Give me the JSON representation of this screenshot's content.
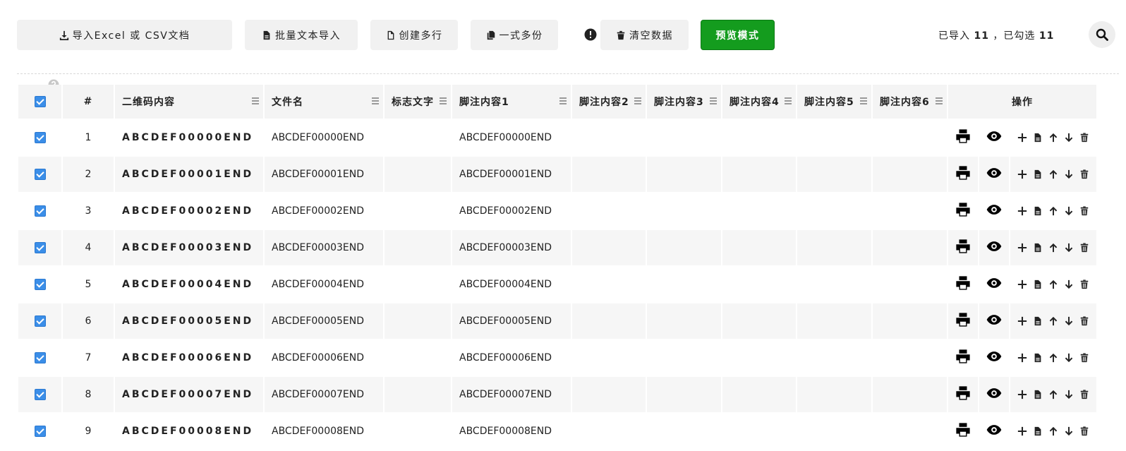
{
  "toolbar": {
    "import_excel": "导入Excel 或 CSV文档",
    "batch_text": "批量文本导入",
    "create_rows": "创建多行",
    "multi_copy": "一式多份",
    "clear_data": "清空数据",
    "preview_mode": "预览模式",
    "status_prefix": "已导入",
    "imported_count": "11",
    "status_sep": "，已勾选",
    "checked_count": "11"
  },
  "table": {
    "headers": {
      "index": "#",
      "qr": "二维码内容",
      "filename": "文件名",
      "flag": "标志文字",
      "foot1": "脚注内容1",
      "foot2": "脚注内容2",
      "foot3": "脚注内容3",
      "foot4": "脚注内容4",
      "foot5": "脚注内容5",
      "foot6": "脚注内容6",
      "ops": "操作"
    },
    "rows": [
      {
        "index": "1",
        "qr": "ABCDEF00000END",
        "filename": "ABCDEF00000END",
        "flag": "",
        "foot1": "ABCDEF00000END"
      },
      {
        "index": "2",
        "qr": "ABCDEF00001END",
        "filename": "ABCDEF00001END",
        "flag": "",
        "foot1": "ABCDEF00001END"
      },
      {
        "index": "3",
        "qr": "ABCDEF00002END",
        "filename": "ABCDEF00002END",
        "flag": "",
        "foot1": "ABCDEF00002END"
      },
      {
        "index": "4",
        "qr": "ABCDEF00003END",
        "filename": "ABCDEF00003END",
        "flag": "",
        "foot1": "ABCDEF00003END"
      },
      {
        "index": "5",
        "qr": "ABCDEF00004END",
        "filename": "ABCDEF00004END",
        "flag": "",
        "foot1": "ABCDEF00004END"
      },
      {
        "index": "6",
        "qr": "ABCDEF00005END",
        "filename": "ABCDEF00005END",
        "flag": "",
        "foot1": "ABCDEF00005END"
      },
      {
        "index": "7",
        "qr": "ABCDEF00006END",
        "filename": "ABCDEF00006END",
        "flag": "",
        "foot1": "ABCDEF00006END"
      },
      {
        "index": "8",
        "qr": "ABCDEF00007END",
        "filename": "ABCDEF00007END",
        "flag": "",
        "foot1": "ABCDEF00007END"
      },
      {
        "index": "9",
        "qr": "ABCDEF00008END",
        "filename": "ABCDEF00008END",
        "flag": "",
        "foot1": "ABCDEF00008END"
      }
    ]
  },
  "icons": {
    "download": "download-icon",
    "file": "file-icon",
    "file_outline": "file-outline-icon",
    "copy": "copy-icon",
    "alert": "exclamation-circle-icon",
    "trash": "trash-icon",
    "search": "search-icon",
    "help": "question-circle-icon",
    "print": "print-icon",
    "eye": "eye-icon",
    "plus": "plus-icon",
    "arrow_up": "arrow-up-icon",
    "arrow_down": "arrow-down-icon"
  },
  "colors": {
    "primary_button": "#149c1e",
    "checkbox": "#3b8ee8"
  }
}
